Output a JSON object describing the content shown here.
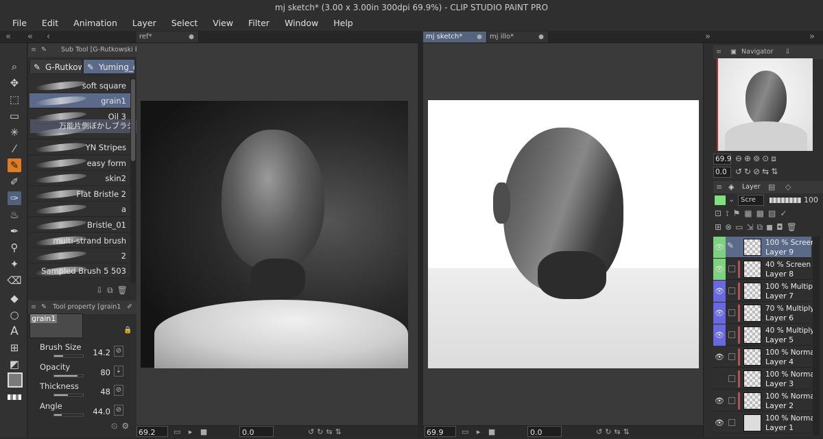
{
  "window": {
    "title": "mj sketch* (3.00 x 3.00in 300dpi 69.9%)  - CLIP STUDIO PAINT PRO"
  },
  "menu": [
    "File",
    "Edit",
    "Animation",
    "Layer",
    "Select",
    "View",
    "Filter",
    "Window",
    "Help"
  ],
  "doc_tabs": {
    "left": "ref*",
    "right_active": "mj sketch*",
    "right_other": "mj illo*"
  },
  "subtool": {
    "header": "Sub Tool [G-Rutkowski brus",
    "groups": [
      "G-Rutkow",
      "Yuming_e"
    ],
    "brushes": [
      "soft square",
      "grain1",
      "Oil 3",
      "",
      "YN Stripes",
      "easy form",
      "skin2",
      "Flat Bristle 2",
      "a",
      "Bristle_01",
      "multi-strand brush",
      "2",
      "Sampled Brush 5 503"
    ],
    "drag_ghost": "万能片側ぼかしブラシ",
    "selected": "grain1"
  },
  "tool_property": {
    "header": "Tool property [grain1",
    "brush_name": "grain1",
    "props": [
      {
        "label": "Brush Size",
        "value": "14.2",
        "fill": 0.3
      },
      {
        "label": "Opacity",
        "value": "80",
        "fill": 0.8
      },
      {
        "label": "Thickness",
        "value": "48",
        "fill": 0.48
      },
      {
        "label": "Angle",
        "value": "44.0",
        "fill": 0.25
      }
    ]
  },
  "canvas_left": {
    "zoom": "69.2",
    "rotation": "0.0"
  },
  "canvas_right": {
    "zoom": "69.9",
    "rotation": "0.0"
  },
  "navigator": {
    "title": "Navigator",
    "zoom": "69.9",
    "rotation": "0.0"
  },
  "layer_panel": {
    "title": "Layer",
    "blend_mode": "Scre",
    "opacity": "100",
    "layers": [
      {
        "mode": "100 % Screen",
        "name": "Layer 9",
        "color": "#7ed17e",
        "selected": true
      },
      {
        "mode": "40 % Screen",
        "name": "Layer 8",
        "color": "#7ed17e",
        "selected": false
      },
      {
        "mode": "100 % Multiply",
        "name": "Layer 7",
        "color": "#6868e0",
        "selected": false
      },
      {
        "mode": "70 % Multiply",
        "name": "Layer 6",
        "color": "#6868e0",
        "selected": false
      },
      {
        "mode": "40 % Multiply",
        "name": "Layer 5",
        "color": "#6868e0",
        "selected": false
      },
      {
        "mode": "100 % Normal",
        "name": "Layer 4",
        "color": "",
        "selected": false
      },
      {
        "mode": "100 % Normal",
        "name": "Layer 3",
        "color": "",
        "selected": false
      },
      {
        "mode": "100 % Normal",
        "name": "Layer 2",
        "color": "",
        "selected": false
      },
      {
        "mode": "100 % Normal",
        "name": "Layer 1",
        "color": "",
        "selected": false
      }
    ]
  },
  "colors": {
    "accent_orange": "#e07d22",
    "selection_blue": "#5a6a88",
    "main_color": "#7a7a7a"
  }
}
